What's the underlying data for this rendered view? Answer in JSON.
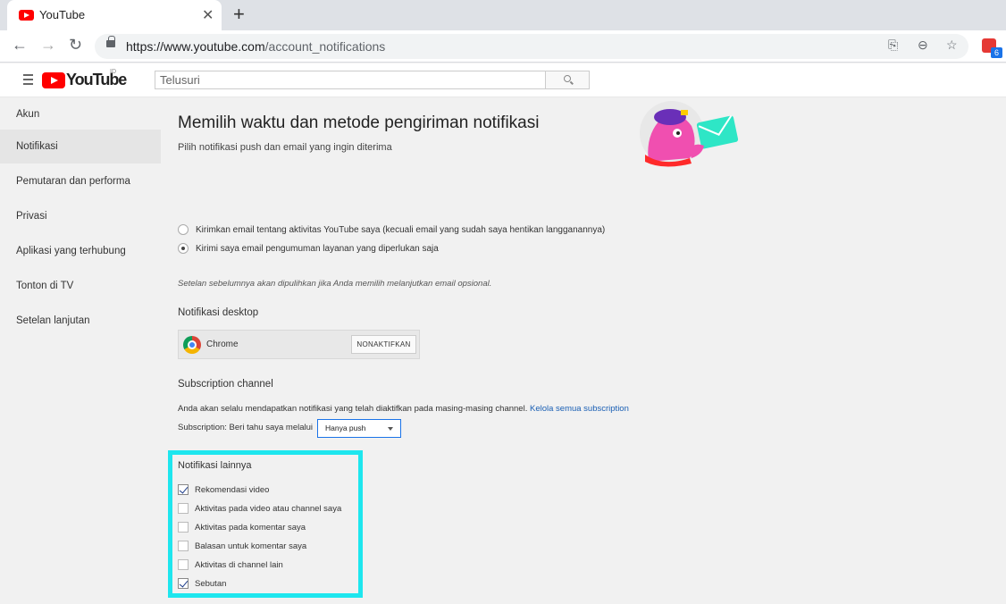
{
  "browser": {
    "tab_title": "YouTube",
    "tab_close": "✕",
    "new_tab": "+",
    "back": "←",
    "forward": "→",
    "reload": "↻",
    "url_host": "https://www.youtube.com",
    "url_path": "/account_notifications",
    "ext_badge": "6"
  },
  "header": {
    "logo_text": "YouTube",
    "country": "ID",
    "search_placeholder": "Telusuri"
  },
  "sidebar": {
    "items": [
      {
        "label": "Akun"
      },
      {
        "label": "Notifikasi"
      },
      {
        "label": "Pemutaran dan performa"
      },
      {
        "label": "Privasi"
      },
      {
        "label": "Aplikasi yang terhubung"
      },
      {
        "label": "Tonton di TV"
      },
      {
        "label": "Setelan lanjutan"
      }
    ],
    "active_index": 1
  },
  "main": {
    "title": "Memilih waktu dan metode pengiriman notifikasi",
    "subtitle": "Pilih notifikasi push dan email yang ingin diterima",
    "email_options": [
      {
        "label": "Kirimkan email tentang aktivitas YouTube saya (kecuali email yang sudah saya hentikan langganannya)",
        "selected": false
      },
      {
        "label": "Kirimi saya email pengumuman layanan yang diperlukan saja",
        "selected": true
      }
    ],
    "note": "Setelan sebelumnya akan dipulihkan jika Anda memilih melanjutkan email opsional.",
    "desktop": {
      "heading": "Notifikasi desktop",
      "browser_name": "Chrome",
      "button": "NONAKTIFKAN"
    },
    "subscription": {
      "heading": "Subscription channel",
      "desc": "Anda akan selalu mendapatkan notifikasi yang telah diaktifkan pada masing-masing channel.",
      "link": "Kelola semua subscription",
      "select_label": "Subscription: Beri tahu saya melalui",
      "select_value": "Hanya push"
    },
    "other": {
      "heading": "Notifikasi lainnya",
      "items": [
        {
          "label": "Rekomendasi video",
          "checked": true
        },
        {
          "label": "Aktivitas pada video atau channel saya",
          "checked": false
        },
        {
          "label": "Aktivitas pada komentar saya",
          "checked": false
        },
        {
          "label": "Balasan untuk komentar saya",
          "checked": false
        },
        {
          "label": "Aktivitas di channel lain",
          "checked": false
        },
        {
          "label": "Sebutan",
          "checked": true
        }
      ]
    }
  },
  "colors": {
    "highlight": "#1ee6ee",
    "brand_red": "#ff0000",
    "link": "#1a5fb4"
  }
}
